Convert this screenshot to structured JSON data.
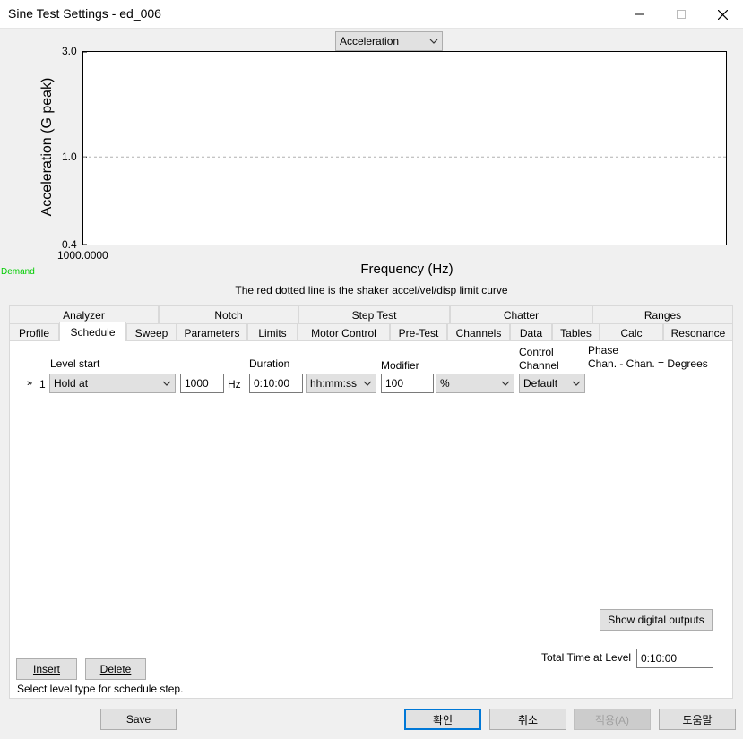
{
  "window": {
    "title": "Sine Test Settings - ed_006"
  },
  "chart": {
    "mode_select": "Acceleration",
    "y_axis_label": "Acceleration (G peak)",
    "y_ticks": [
      "3.0",
      "1.0",
      "0.4"
    ],
    "x_tick": "1000.0000",
    "x_axis_label": "Frequency (Hz)",
    "legend_demand": "Demand",
    "note": "The red dotted line is the shaker accel/vel/disp limit curve",
    "demand_color": "#00cc00"
  },
  "chart_data": {
    "type": "line",
    "ylabel": "Acceleration (G peak)",
    "xlabel": "Frequency (Hz)",
    "ylim": [
      0.4,
      3.0
    ],
    "y_scale": "log",
    "y_ticks": [
      3.0,
      1.0,
      0.4
    ],
    "x_ticks": [
      1000.0
    ],
    "reference_lines": [
      {
        "y": 1.0,
        "style": "dotted",
        "color": "#b0b0b0"
      }
    ],
    "series": [
      {
        "name": "Demand",
        "values": []
      }
    ]
  },
  "tabs": {
    "row1": [
      "Analyzer",
      "Notch",
      "Step Test",
      "Chatter",
      "Ranges"
    ],
    "row2": [
      "Profile",
      "Schedule",
      "Sweep",
      "Parameters",
      "Limits",
      "Motor Control",
      "Pre-Test",
      "Channels",
      "Data",
      "Tables",
      "Calc",
      "Resonance"
    ],
    "active": "Schedule"
  },
  "schedule": {
    "col_level_start": "Level start",
    "col_duration": "Duration",
    "col_modifier": "Modifier",
    "col_control_channel": "Control\nChannel",
    "col_phase_line1": "Phase",
    "col_phase_line2": "Chan. - Chan. = Degrees",
    "row_marker": "»",
    "row_number": "1",
    "level_type": "Hold at",
    "frequency": "1000",
    "freq_unit": "Hz",
    "duration": "0:10:00",
    "duration_format": "hh:mm:ss",
    "modifier_value": "100",
    "modifier_unit": "%",
    "control_channel": "Default",
    "show_digital_outputs": "Show digital outputs",
    "total_time_label": "Total Time at Level",
    "total_time_value": "0:10:00",
    "insert_label": "Insert",
    "delete_label": "Delete",
    "status": "Select level type for schedule step."
  },
  "footer": {
    "save": "Save",
    "ok": "확인",
    "cancel": "취소",
    "apply": "적용(A)",
    "help": "도움말"
  }
}
